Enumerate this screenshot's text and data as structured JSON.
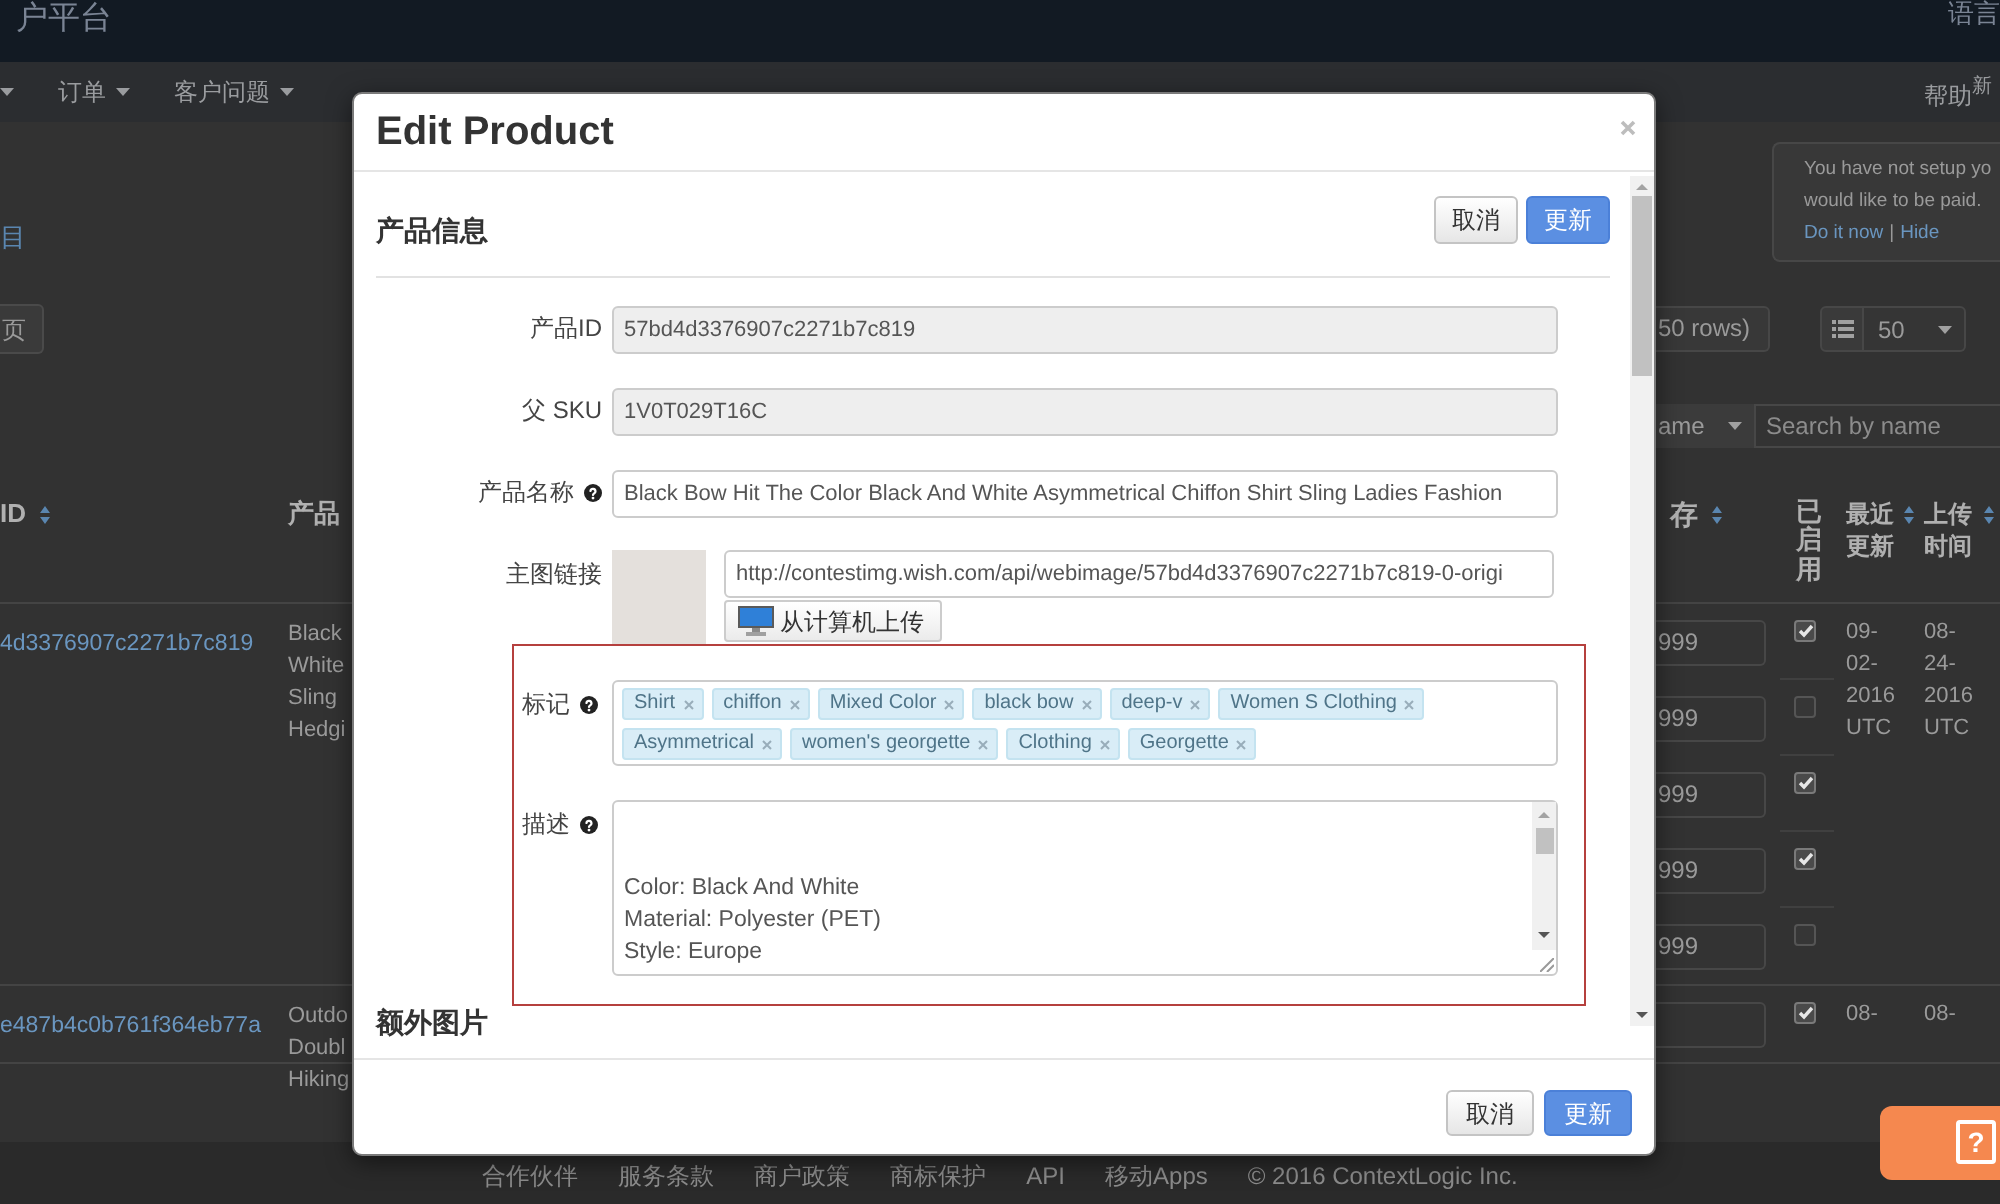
{
  "top_bar": {
    "brand": "户平台",
    "language": "语言"
  },
  "nav": {
    "items": [
      {
        "caret": true
      },
      {
        "label": "订单",
        "caret": true
      },
      {
        "label": "客户问题",
        "caret": true
      }
    ],
    "help": "帮助",
    "help_badge": "新"
  },
  "left_panel": {
    "section_link": "目",
    "page_button": "页"
  },
  "notice": {
    "lines": [
      "You have not setup yo",
      "would like to be paid."
    ],
    "links": [
      "Do it now",
      "Hide"
    ],
    "separator": "|"
  },
  "pagination": {
    "row_count": "50 rows)",
    "page_size": "50"
  },
  "filter": {
    "field": "ame",
    "search_placeholder": "Search by name"
  },
  "table": {
    "columns": [
      {
        "label": "ID",
        "sortable": true
      },
      {
        "label": "产品",
        "sortable": false
      },
      {
        "label": "存",
        "sortable": true
      },
      {
        "label": "已启用",
        "sortable": false
      },
      {
        "label": "最近更新",
        "sortable": true
      },
      {
        "label": "上传时间",
        "sortable": true
      }
    ],
    "rows": [
      {
        "id": "4d3376907c2271b7c819",
        "name": "Black White Sling Hedgi",
        "variants": [
          {
            "inventory": "999",
            "enabled": true
          },
          {
            "inventory": "999",
            "enabled": false
          },
          {
            "inventory": "999",
            "enabled": true
          },
          {
            "inventory": "999",
            "enabled": true
          },
          {
            "inventory": "999",
            "enabled": false
          }
        ],
        "last_updated": [
          "09-",
          "02-",
          "2016",
          "UTC"
        ],
        "uploaded": [
          "08-",
          "24-",
          "2016",
          "UTC"
        ]
      },
      {
        "id": "e487b4c0b761f364eb77a",
        "name": "Outdo Doubl Hiking",
        "variants": [
          {
            "enabled": true
          }
        ],
        "last_updated": [
          "08-"
        ],
        "uploaded": [
          "08-"
        ]
      }
    ]
  },
  "modal": {
    "title": "Edit Product",
    "section": {
      "title": "产品信息",
      "buttons": [
        {
          "label": "取消",
          "kind": "default"
        },
        {
          "label": "更新",
          "kind": "primary"
        }
      ]
    },
    "fields": [
      {
        "kind": "input",
        "label": "产品ID",
        "help": false,
        "disabled": true,
        "highlighted": false,
        "value": "57bd4d3376907c2271b7c819"
      },
      {
        "kind": "input",
        "label": "父 SKU",
        "help": false,
        "disabled": true,
        "highlighted": false,
        "value": "1V0T029T16C"
      },
      {
        "kind": "input",
        "label": "产品名称",
        "help": true,
        "disabled": false,
        "highlighted": false,
        "value": "Black Bow Hit The Color Black And White Asymmetrical Chiffon Shirt Sling Ladies Fashion"
      },
      {
        "kind": "image",
        "label": "主图链接",
        "help": false,
        "highlighted": false,
        "value": "http://contestimg.wish.com/api/webimage/57bd4d3376907c2271b7c819-0-origi",
        "upload_button": "从计算机上传"
      },
      {
        "kind": "tags",
        "label": "标记",
        "help": true,
        "highlighted": true,
        "tags": [
          "Shirt",
          "chiffon",
          "Mixed Color",
          "black bow",
          "deep-v",
          "Women S Clothing",
          "Asymmetrical",
          "women's georgette",
          "Clothing",
          "Georgette"
        ]
      },
      {
        "kind": "textarea",
        "label": "描述",
        "help": true,
        "highlighted": true,
        "lines": [
          "Color: Black And White",
          "Material: Polyester (PET)",
          "Style: Europe"
        ]
      }
    ],
    "next_section": "额外图片",
    "footer_buttons": [
      {
        "label": "取消",
        "kind": "default"
      },
      {
        "label": "更新",
        "kind": "primary"
      }
    ]
  },
  "footer": {
    "links": [
      "合作伙伴",
      "服务条款",
      "商户政策",
      "商标保护",
      "API",
      "移动Apps"
    ],
    "copyright": "© 2016 ContextLogic Inc."
  },
  "feedback_button": {
    "label": "?"
  }
}
